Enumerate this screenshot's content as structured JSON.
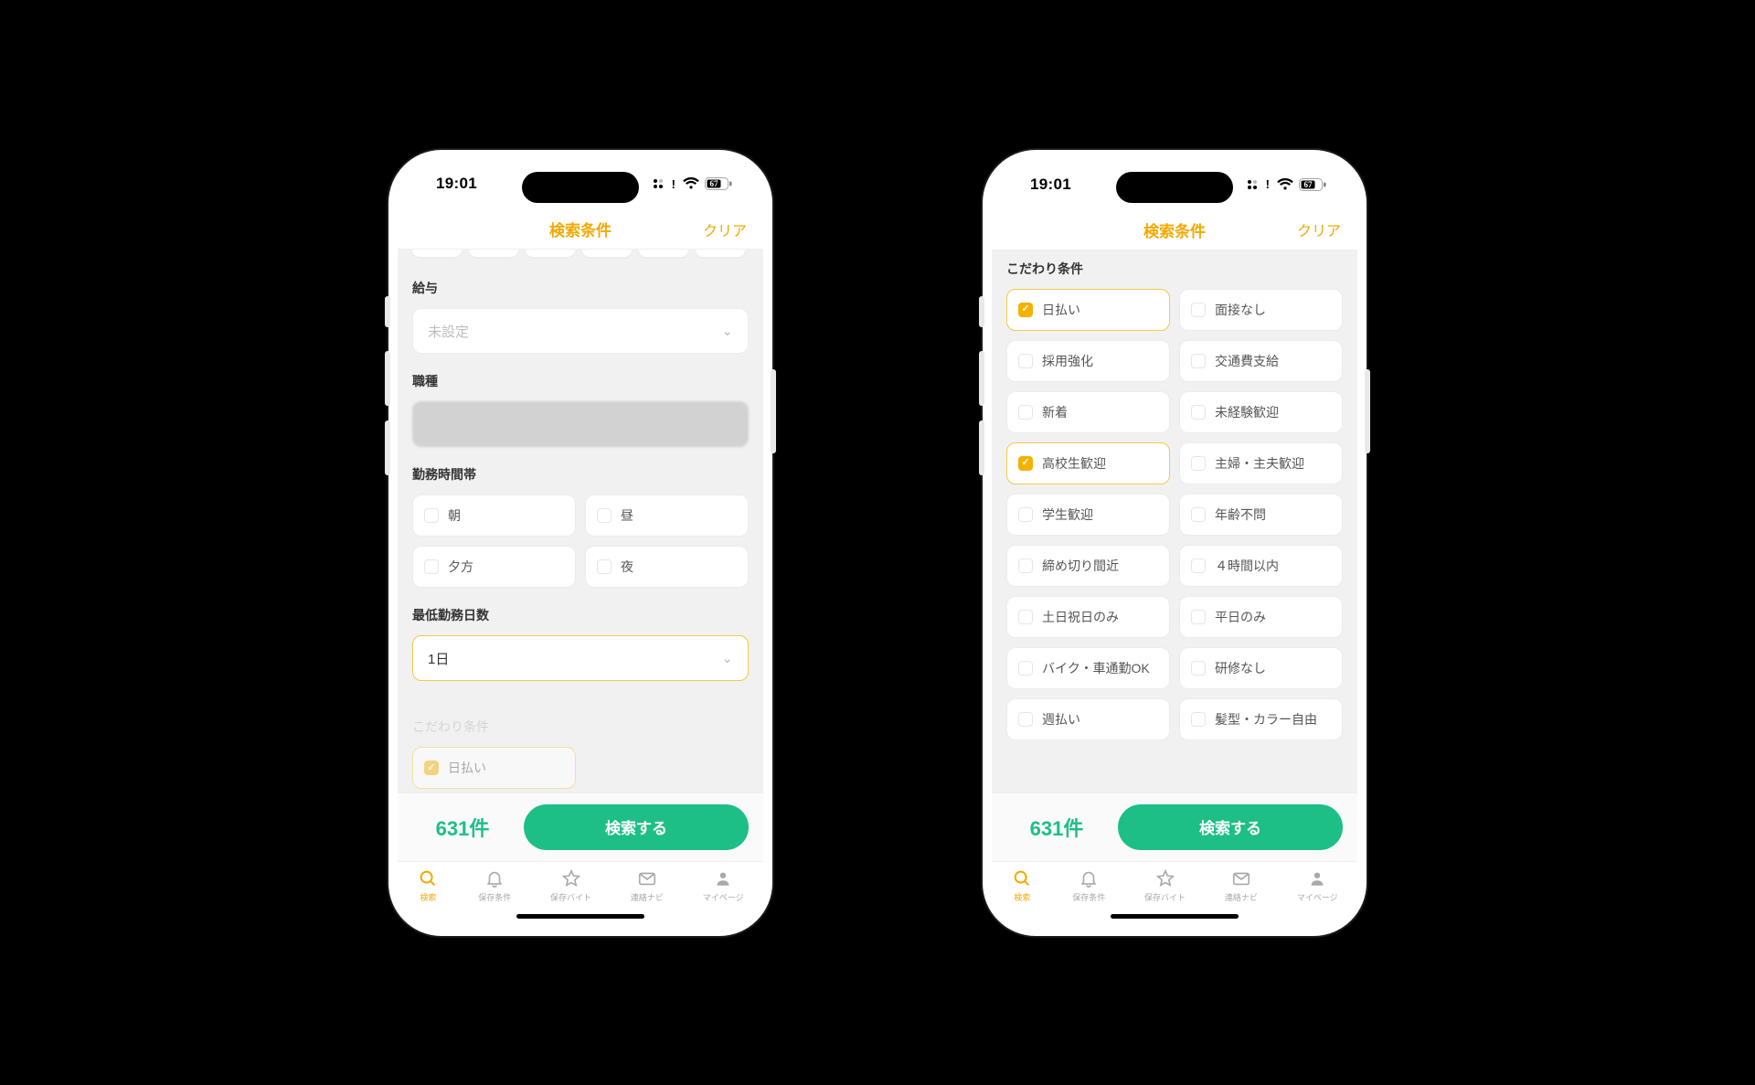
{
  "statusbar": {
    "time": "19:01",
    "battery": "67"
  },
  "titlebar": {
    "title": "検索条件",
    "clear": "クリア"
  },
  "phone1": {
    "salary": {
      "label": "給与",
      "placeholder": "未設定"
    },
    "jobtype": {
      "label": "職種",
      "placeholder": " "
    },
    "timeslot": {
      "label": "勤務時間帯",
      "options": [
        "朝",
        "昼",
        "夕方",
        "夜"
      ]
    },
    "mindays": {
      "label": "最低勤務日数",
      "value": "1日"
    },
    "preferences_label": "こだわり条件",
    "pref_peek": "日払い"
  },
  "phone2": {
    "preferences_label": "こだわり条件",
    "prefs": [
      {
        "label": "日払い",
        "checked": true
      },
      {
        "label": "面接なし",
        "checked": false
      },
      {
        "label": "採用強化",
        "checked": false
      },
      {
        "label": "交通費支給",
        "checked": false
      },
      {
        "label": "新着",
        "checked": false
      },
      {
        "label": "未経験歓迎",
        "checked": false
      },
      {
        "label": "高校生歓迎",
        "checked": true
      },
      {
        "label": "主婦・主夫歓迎",
        "checked": false
      },
      {
        "label": "学生歓迎",
        "checked": false
      },
      {
        "label": "年齢不問",
        "checked": false
      },
      {
        "label": "締め切り間近",
        "checked": false
      },
      {
        "label": "４時間以内",
        "checked": false
      },
      {
        "label": "土日祝日のみ",
        "checked": false
      },
      {
        "label": "平日のみ",
        "checked": false
      },
      {
        "label": "バイク・車通勤OK",
        "checked": false
      },
      {
        "label": "研修なし",
        "checked": false
      },
      {
        "label": "週払い",
        "checked": false
      },
      {
        "label": "髪型・カラー自由",
        "checked": false
      }
    ]
  },
  "footer": {
    "count": "631件",
    "search_label": "検索する"
  },
  "tabs": [
    {
      "label": "検索",
      "icon": "search-icon",
      "active": true
    },
    {
      "label": "保存条件",
      "icon": "bell-icon",
      "active": false
    },
    {
      "label": "保存バイト",
      "icon": "star-icon",
      "active": false
    },
    {
      "label": "連絡ナビ",
      "icon": "mail-icon",
      "active": false
    },
    {
      "label": "マイページ",
      "icon": "person-icon",
      "active": false
    }
  ]
}
